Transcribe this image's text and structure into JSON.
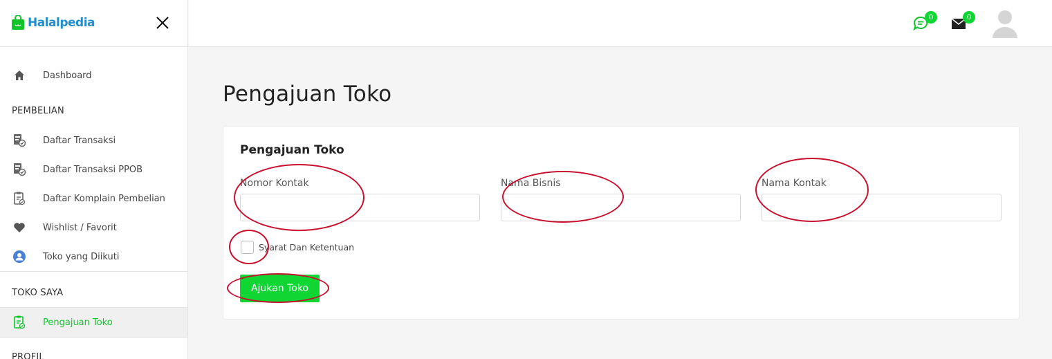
{
  "brand": {
    "name": "Halalpedia"
  },
  "sidebar": {
    "dashboard": "Dashboard",
    "section_purchase": "PEMBELIAN",
    "purchase_items": [
      {
        "label": "Daftar Transaksi",
        "icon": "transaction-list-icon"
      },
      {
        "label": "Daftar Transaksi PPOB",
        "icon": "ppob-transaction-icon"
      },
      {
        "label": "Daftar Komplain Pembelian",
        "icon": "complaint-clipboard-icon"
      },
      {
        "label": "Wishlist / Favorit",
        "icon": "heart-icon"
      },
      {
        "label": "Toko yang Diikuti",
        "icon": "followed-store-icon"
      }
    ],
    "section_store": "TOKO SAYA",
    "store_items": [
      {
        "label": "Pengajuan Toko",
        "icon": "store-application-icon",
        "active": true
      }
    ],
    "section_profile": "PROFIL"
  },
  "header": {
    "chat_count": "0",
    "mail_count": "0"
  },
  "main": {
    "page_title": "Pengajuan Toko",
    "card_title": "Pengajuan Toko",
    "fields": [
      {
        "label": "Nomor Kontak",
        "value": "",
        "placeholder": ""
      },
      {
        "label": "Nama Bisnis",
        "value": "",
        "placeholder": ""
      },
      {
        "label": "Nama Kontak",
        "value": "",
        "placeholder": ""
      }
    ],
    "terms_label": "Syarat Dan Ketentuan",
    "submit_label": "Ajukan Toko"
  },
  "colors": {
    "accent_green": "#10d634",
    "brand_blue": "#1f8fd0",
    "annotation_red": "#c8102e"
  }
}
